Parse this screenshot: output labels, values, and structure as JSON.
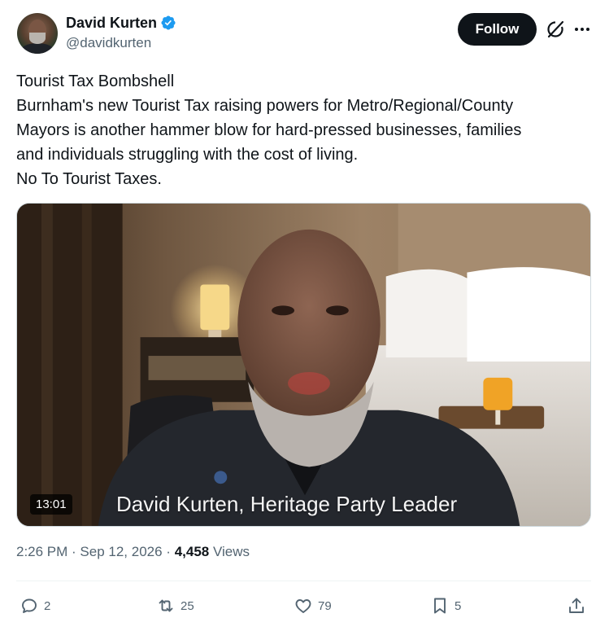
{
  "author": {
    "display_name": "David Kurten",
    "handle": "@davidkurten",
    "verified": true
  },
  "header": {
    "follow_label": "Follow",
    "grok_icon": "grok-icon",
    "more_icon": "more-icon"
  },
  "tweet": {
    "lines": [
      "Tourist Tax Bombshell",
      "Burnham's new Tourist Tax raising powers for Metro/Regional/County",
      "Mayors is another hammer blow for hard-pressed businesses, families",
      "and individuals struggling with the cost of living.",
      "No To Tourist Taxes."
    ]
  },
  "media": {
    "caption": "David Kurten, Heritage Party Leader",
    "duration": "13:01"
  },
  "meta": {
    "time": "2:26 PM",
    "separator": " · ",
    "date": "Sep 12, 2026",
    "views_count": "4,458",
    "views_label": "Views"
  },
  "actions": {
    "replies": "2",
    "reposts": "25",
    "likes": "79",
    "bookmarks": "5"
  },
  "colors": {
    "text_primary": "#0f1419",
    "text_secondary": "#536471",
    "verified_blue": "#1d9bf0",
    "follow_bg": "#0f1419"
  }
}
